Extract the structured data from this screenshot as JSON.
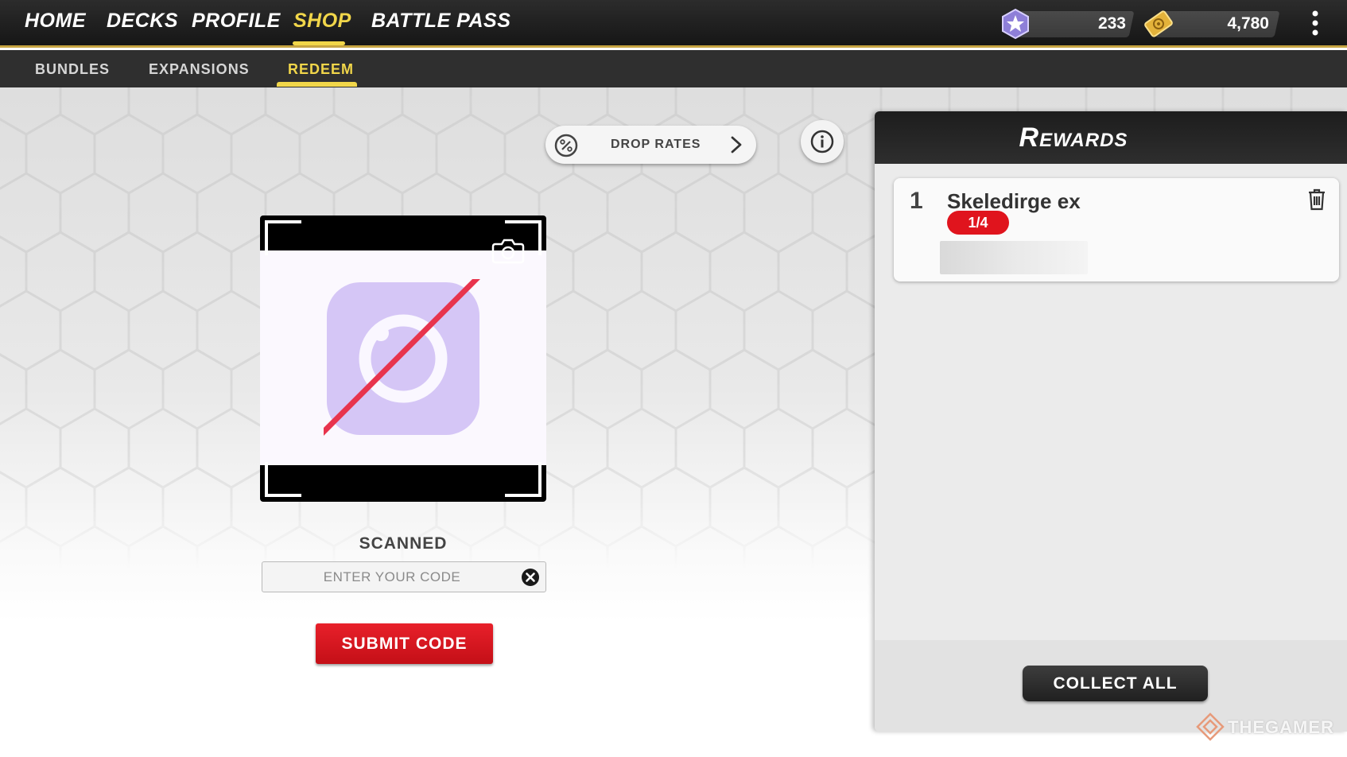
{
  "nav": {
    "items": [
      {
        "label": "HOME",
        "active": false
      },
      {
        "label": "DECKS",
        "active": false
      },
      {
        "label": "PROFILE",
        "active": false
      },
      {
        "label": "SHOP",
        "active": true
      },
      {
        "label": "BATTLE PASS",
        "active": false
      }
    ]
  },
  "currencies": [
    {
      "icon": "star-badge-icon",
      "value": "233"
    },
    {
      "icon": "ticket-coin-icon",
      "value": "4,780"
    }
  ],
  "subnav": {
    "items": [
      {
        "label": "BUNDLES",
        "active": false
      },
      {
        "label": "EXPANSIONS",
        "active": false
      },
      {
        "label": "REDEEM",
        "active": true
      }
    ]
  },
  "drop_rates": {
    "label": "DROP RATES"
  },
  "scanner": {
    "status": "SCANNED"
  },
  "code_input": {
    "placeholder": "ENTER YOUR CODE",
    "value": ""
  },
  "submit": {
    "label": "SUBMIT CODE"
  },
  "rewards": {
    "title": "Rewards",
    "items": [
      {
        "index": "1",
        "name": "Skeledirge ex",
        "progress": "1/4"
      }
    ],
    "collect_label": "COLLECT ALL"
  },
  "watermark": "THEGAMER",
  "colors": {
    "accent_gold": "#f1d64a",
    "submit_red": "#e0141d",
    "camera_purple": "#d5c6f6",
    "strike_red": "#e8344d"
  }
}
